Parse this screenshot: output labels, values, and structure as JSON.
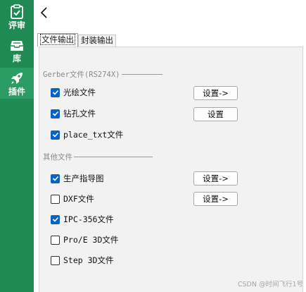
{
  "sidebar": {
    "items": [
      {
        "label": "评审",
        "icon": "clipboard-check-icon",
        "active": false
      },
      {
        "label": "库",
        "icon": "inbox-tray-icon",
        "active": false
      },
      {
        "label": "插件",
        "icon": "rocket-icon",
        "active": true
      }
    ],
    "color": "#1f8a53",
    "active_color": "#2a9c64"
  },
  "header": {
    "back_icon": "chevron-left-icon"
  },
  "tabs": [
    {
      "label": "文件输出",
      "active": true
    },
    {
      "label": "封装输出",
      "active": false
    }
  ],
  "groups": {
    "gerber": {
      "title": "Gerber文件(RS274X)"
    },
    "other": {
      "title": "其他文件"
    }
  },
  "options": {
    "photo_file": {
      "label": "光绘文件",
      "checked": true,
      "button": "设置->"
    },
    "drill_file": {
      "label": "钻孔文件",
      "checked": true,
      "button": "设置"
    },
    "place_txt": {
      "label": "place_txt文件",
      "checked": true
    },
    "production_guide": {
      "label": "生产指导图",
      "checked": true,
      "button": "设置->"
    },
    "dxf_file": {
      "label": "DXF文件",
      "checked": false,
      "button": "设置->"
    },
    "ipc356_file": {
      "label": "IPC-356文件",
      "checked": true
    },
    "proe_3d": {
      "label": "Pro/E 3D文件",
      "checked": false
    },
    "step_3d": {
      "label": "Step 3D文件",
      "checked": false
    }
  },
  "accent_color": "#0a63c4",
  "watermark": "CSDN @时间飞行1号"
}
